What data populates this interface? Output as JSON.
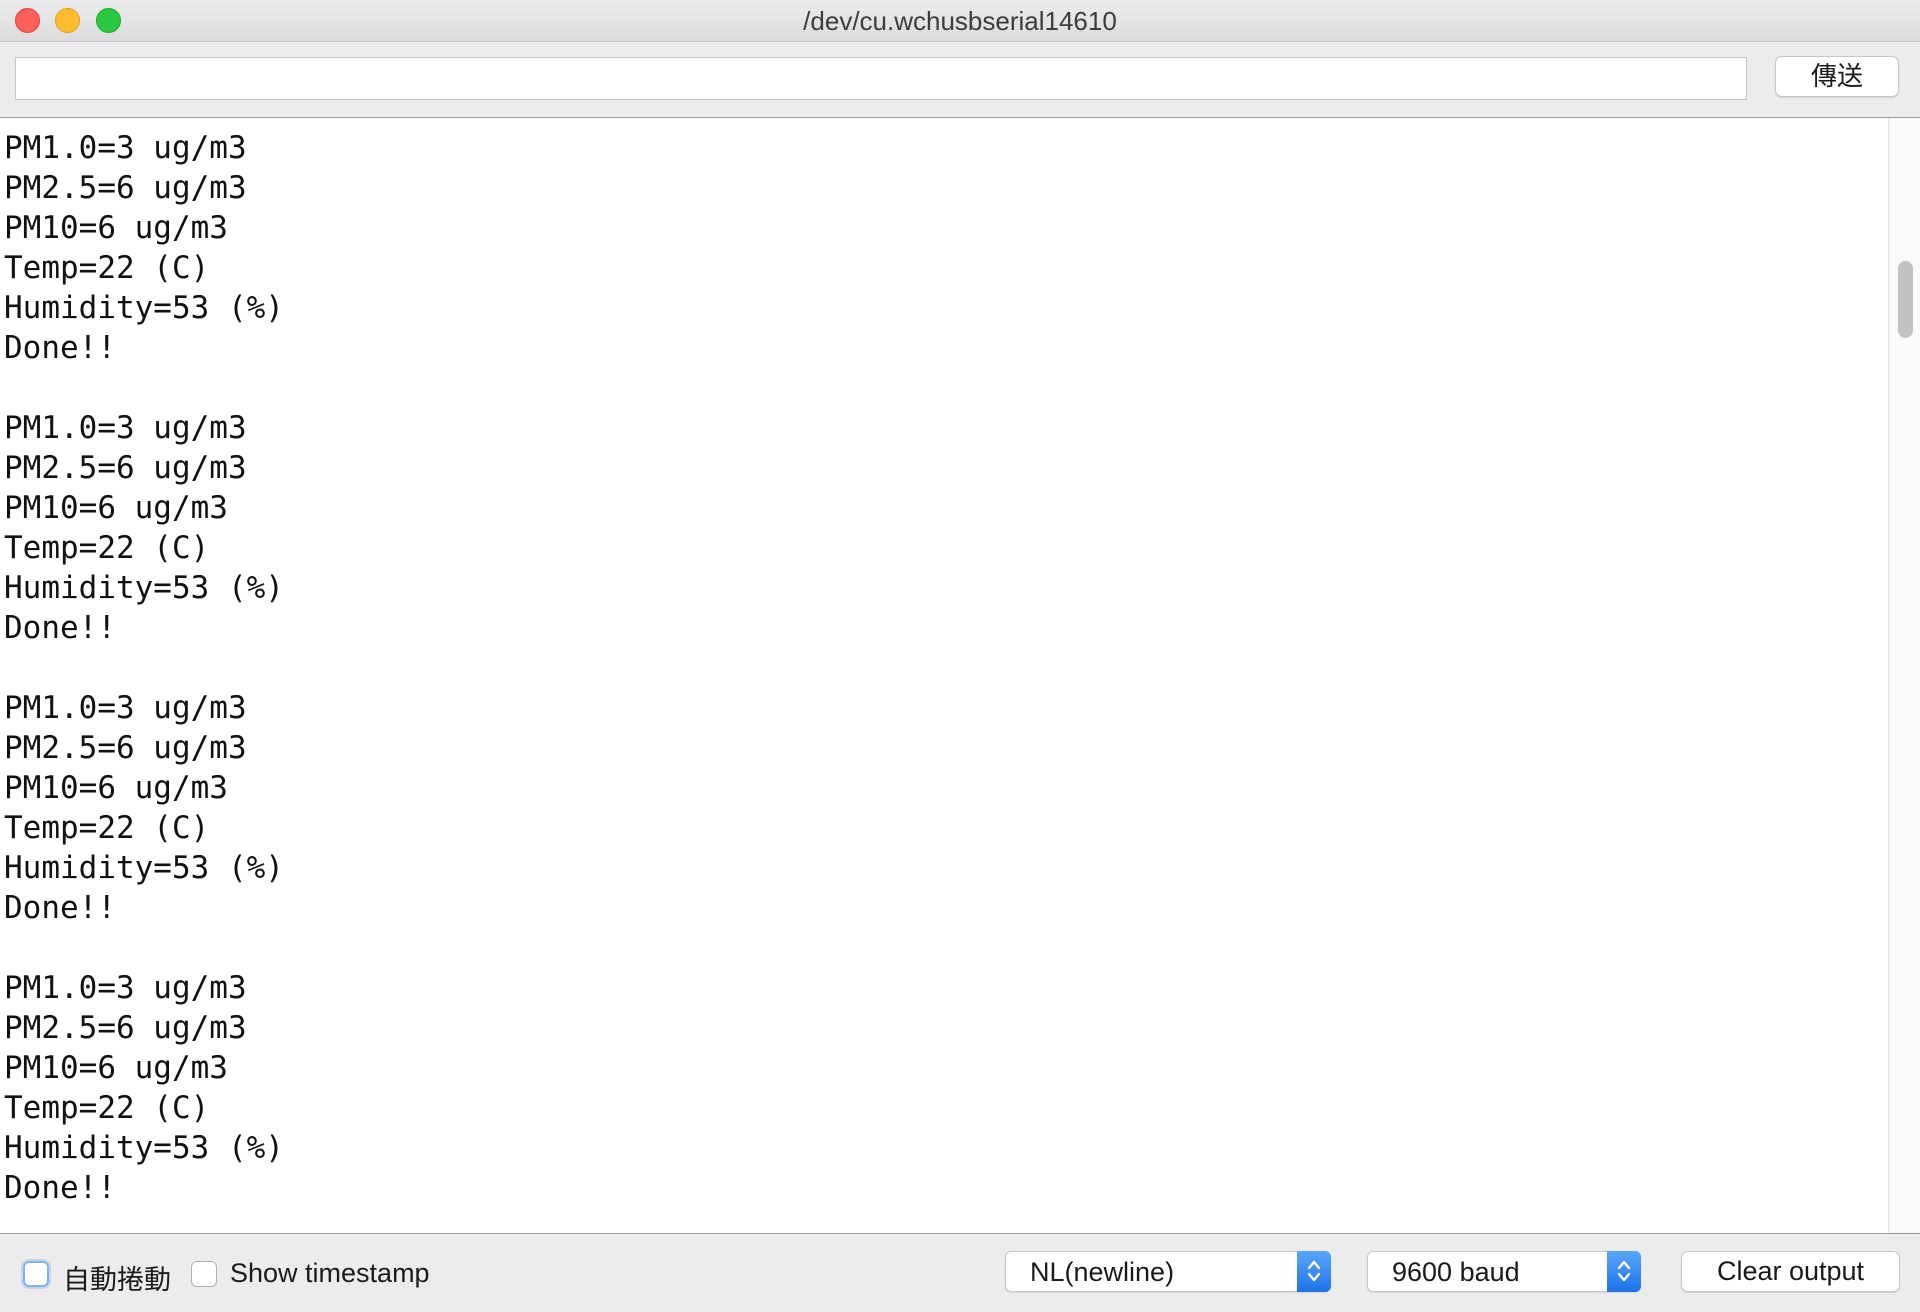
{
  "window": {
    "title": "/dev/cu.wchusbserial14610"
  },
  "send_bar": {
    "input_value": "",
    "send_label": "傳送"
  },
  "output": {
    "lines": [
      "PM1.0=3 ug/m3",
      "PM2.5=6 ug/m3",
      "PM10=6 ug/m3",
      "Temp=22 (C)",
      "Humidity=53 (%)",
      "Done!!",
      "",
      "PM1.0=3 ug/m3",
      "PM2.5=6 ug/m3",
      "PM10=6 ug/m3",
      "Temp=22 (C)",
      "Humidity=53 (%)",
      "Done!!",
      "",
      "PM1.0=3 ug/m3",
      "PM2.5=6 ug/m3",
      "PM10=6 ug/m3",
      "Temp=22 (C)",
      "Humidity=53 (%)",
      "Done!!",
      "",
      "PM1.0=3 ug/m3",
      "PM2.5=6 ug/m3",
      "PM10=6 ug/m3",
      "Temp=22 (C)",
      "Humidity=53 (%)",
      "Done!!"
    ]
  },
  "footer": {
    "autoscroll_label": "自動捲動",
    "autoscroll_checked": false,
    "timestamp_label": "Show timestamp",
    "timestamp_checked": false,
    "line_ending": "NL(newline)",
    "baud_rate": "9600 baud",
    "clear_label": "Clear output"
  },
  "colors": {
    "close": "#fe5f57",
    "minimize": "#febc2e",
    "maximize": "#28c840",
    "select_accent": "#1f72e8"
  }
}
